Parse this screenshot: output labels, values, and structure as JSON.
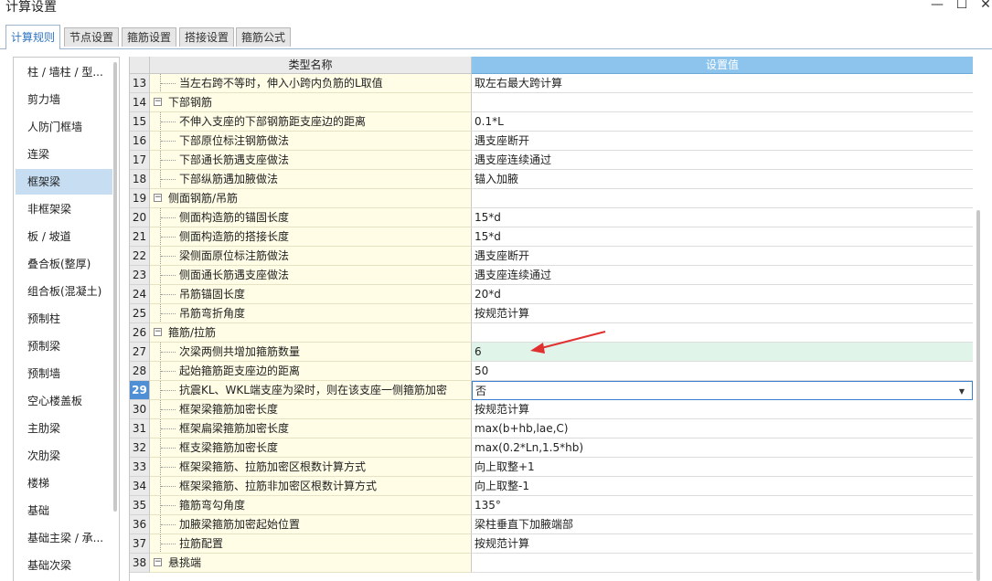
{
  "window": {
    "title": "计算设置",
    "minimize": "—",
    "maximize": "☐",
    "close": "✕"
  },
  "tabs": [
    {
      "label": "计算规则",
      "active": true
    },
    {
      "label": "节点设置",
      "active": false
    },
    {
      "label": "箍筋设置",
      "active": false
    },
    {
      "label": "搭接设置",
      "active": false
    },
    {
      "label": "箍筋公式",
      "active": false
    }
  ],
  "sidebar": {
    "items": [
      {
        "label": "柱 / 墙柱 / 型..."
      },
      {
        "label": "剪力墙"
      },
      {
        "label": "人防门框墙"
      },
      {
        "label": "连梁"
      },
      {
        "label": "框架梁",
        "selected": true
      },
      {
        "label": "非框架梁"
      },
      {
        "label": "板 / 坡道"
      },
      {
        "label": "叠合板(整厚)"
      },
      {
        "label": "组合板(混凝土)"
      },
      {
        "label": "预制柱"
      },
      {
        "label": "预制梁"
      },
      {
        "label": "预制墙"
      },
      {
        "label": "空心楼盖板"
      },
      {
        "label": "主肋梁"
      },
      {
        "label": "次肋梁"
      },
      {
        "label": "楼梯"
      },
      {
        "label": "基础"
      },
      {
        "label": "基础主梁 / 承..."
      },
      {
        "label": "基础次梁"
      }
    ]
  },
  "grid": {
    "headers": {
      "name": "类型名称",
      "value": "设置值"
    },
    "rows": [
      {
        "num": "13",
        "kind": "child",
        "name": "当左右跨不等时，伸入小跨内负筋的L取值",
        "value": "取左右最大跨计算"
      },
      {
        "num": "14",
        "kind": "group",
        "name": "下部钢筋",
        "value": ""
      },
      {
        "num": "15",
        "kind": "child",
        "name": "不伸入支座的下部钢筋距支座边的距离",
        "value": "0.1*L"
      },
      {
        "num": "16",
        "kind": "child",
        "name": "下部原位标注钢筋做法",
        "value": "遇支座断开"
      },
      {
        "num": "17",
        "kind": "child",
        "name": "下部通长筋遇支座做法",
        "value": "遇支座连续通过"
      },
      {
        "num": "18",
        "kind": "child",
        "name": "下部纵筋遇加腋做法",
        "value": "锚入加腋"
      },
      {
        "num": "19",
        "kind": "group",
        "name": "侧面钢筋/吊筋",
        "value": ""
      },
      {
        "num": "20",
        "kind": "child",
        "name": "侧面构造筋的锚固长度",
        "value": "15*d"
      },
      {
        "num": "21",
        "kind": "child",
        "name": "侧面构造筋的搭接长度",
        "value": "15*d"
      },
      {
        "num": "22",
        "kind": "child",
        "name": "梁侧面原位标注筋做法",
        "value": "遇支座断开"
      },
      {
        "num": "23",
        "kind": "child",
        "name": "侧面通长筋遇支座做法",
        "value": "遇支座连续通过"
      },
      {
        "num": "24",
        "kind": "child",
        "name": "吊筋锚固长度",
        "value": "20*d"
      },
      {
        "num": "25",
        "kind": "child",
        "name": "吊筋弯折角度",
        "value": "按规范计算"
      },
      {
        "num": "26",
        "kind": "group",
        "name": "箍筋/拉筋",
        "value": ""
      },
      {
        "num": "27",
        "kind": "child",
        "name": "次梁两侧共增加箍筋数量",
        "value": "6",
        "highlight": true
      },
      {
        "num": "28",
        "kind": "child",
        "name": "起始箍筋距支座边的距离",
        "value": "50"
      },
      {
        "num": "29",
        "kind": "child",
        "name": "抗震KL、WKL端支座为梁时，则在该支座一侧箍筋加密",
        "value": "否",
        "current": true
      },
      {
        "num": "30",
        "kind": "child",
        "name": "框架梁箍筋加密长度",
        "value": "按规范计算"
      },
      {
        "num": "31",
        "kind": "child",
        "name": "框架扁梁箍筋加密长度",
        "value": "max(b+hb,lae,C)"
      },
      {
        "num": "32",
        "kind": "child",
        "name": "框支梁箍筋加密长度",
        "value": "max(0.2*Ln,1.5*hb)"
      },
      {
        "num": "33",
        "kind": "child",
        "name": "框架梁箍筋、拉筋加密区根数计算方式",
        "value": "向上取整+1"
      },
      {
        "num": "34",
        "kind": "child",
        "name": "框架梁箍筋、拉筋非加密区根数计算方式",
        "value": "向上取整-1"
      },
      {
        "num": "35",
        "kind": "child",
        "name": "箍筋弯勾角度",
        "value": "135°"
      },
      {
        "num": "36",
        "kind": "child",
        "name": "加腋梁箍筋加密起始位置",
        "value": "梁柱垂直下加腋端部"
      },
      {
        "num": "37",
        "kind": "child",
        "name": "拉筋配置",
        "value": "按规范计算"
      },
      {
        "num": "38",
        "kind": "group",
        "name": "悬挑端",
        "value": ""
      }
    ]
  },
  "colors": {
    "accent": "#2f74c0",
    "header_value_bg": "#8cc4ee",
    "name_cell_bg": "#fffde6",
    "highlight_row_bg": "#e1f4ea",
    "selected_sidebar_bg": "#c6ddf2",
    "annotation_arrow": "#e03030"
  }
}
